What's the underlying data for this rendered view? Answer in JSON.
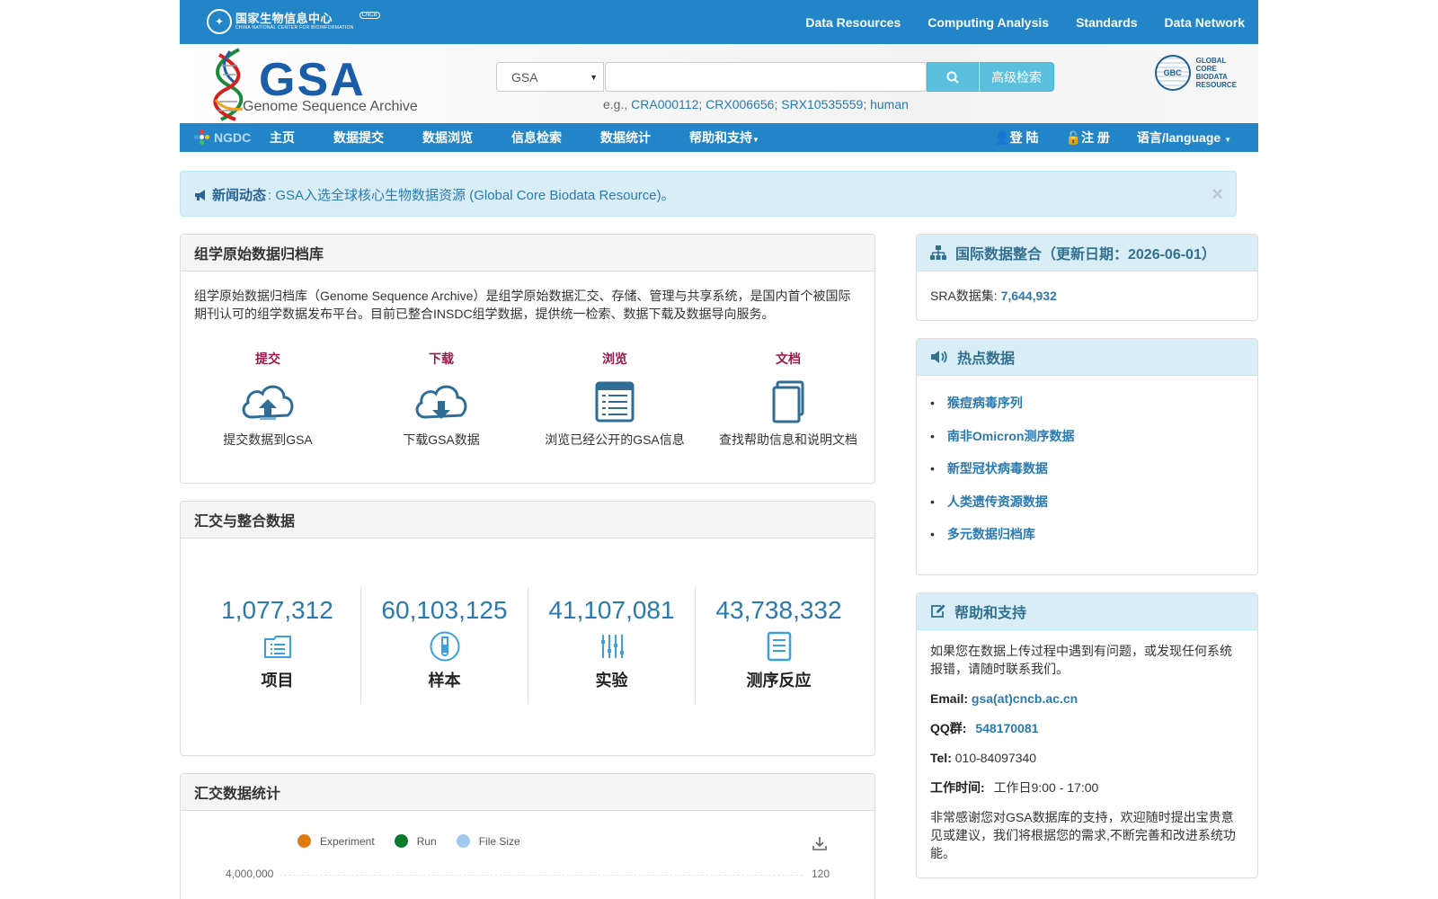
{
  "topbar": {
    "org_cn": "国家生物信息中心",
    "org_en": "CHINA NATIONAL CENTER FOR BIOINFORMATION",
    "org_badge": "CNCB",
    "nav": [
      "Data Resources",
      "Computing Analysis",
      "Standards",
      "Data Network"
    ]
  },
  "header": {
    "logo_title": "GSA",
    "logo_subtitle": "Genome Sequence Archive",
    "search_db": "GSA",
    "search_value": "",
    "advanced_label": "高级检索",
    "examples_prefix": "e.g.,",
    "examples": [
      "CRA000112",
      "CRX006656",
      "SRX10535559",
      "human"
    ],
    "gcbr_text": [
      "GLOBAL",
      "CORE",
      "BIODATA",
      "RESOURCE"
    ],
    "gcbr_badge": "GBC"
  },
  "mainnav": {
    "ngdc": "NGDC",
    "items": [
      "主页",
      "数据提交",
      "数据浏览",
      "信息检索",
      "数据统计",
      "帮助和支持"
    ],
    "login": "登 陆",
    "register": "注 册",
    "language": "语言/language"
  },
  "alert": {
    "label": "新闻动态",
    "text": ": GSA入选全球核心生物数据资源 (Global Core Biodata Resource)。",
    "close": "×"
  },
  "archive": {
    "title": "组学原始数据归档库",
    "intro": "组学原始数据归档库（Genome Sequence Archive）是组学原始数据汇交、存储、管理与共享系统，是国内首个被国际期刊认可的组学数据发布平台。目前已整合INSDC组学数据，提供统一检索、数据下载及数据导向服务。",
    "quick": [
      {
        "title": "提交",
        "desc": "提交数据到GSA",
        "icon": "cloud-upload-icon"
      },
      {
        "title": "下载",
        "desc": "下载GSA数据",
        "icon": "cloud-download-icon"
      },
      {
        "title": "浏览",
        "desc": "浏览已经公开的GSA信息",
        "icon": "list-document-icon"
      },
      {
        "title": "文档",
        "desc": "查找帮助信息和说明文档",
        "icon": "documents-icon"
      }
    ]
  },
  "integration": {
    "title": "汇交与整合数据",
    "stats": [
      {
        "value": "1,077,312",
        "label": "项目",
        "icon": "project-icon"
      },
      {
        "value": "60,103,125",
        "label": "样本",
        "icon": "sample-tube-icon"
      },
      {
        "value": "41,107,081",
        "label": "实验",
        "icon": "experiment-icon"
      },
      {
        "value": "43,738,332",
        "label": "测序反应",
        "icon": "run-document-icon"
      }
    ]
  },
  "submission_stats": {
    "title": "汇交数据统计",
    "legend": [
      {
        "name": "Experiment",
        "color": "#e07b10"
      },
      {
        "name": "Run",
        "color": "#0c7a2c"
      },
      {
        "name": "File Size",
        "color": "#a4c8f0"
      }
    ],
    "y_left_top": "4,000,000",
    "y_right_top": "120"
  },
  "intl": {
    "title": "国际数据整合（更新日期：2026-06-01）",
    "sra_label": "SRA数据集:",
    "sra_value": "7,644,932"
  },
  "hot": {
    "title": "热点数据",
    "items": [
      "猴痘病毒序列",
      "南非Omicron测序数据",
      "新型冠状病毒数据",
      "人类遗传资源数据",
      "多元数据归档库"
    ]
  },
  "help": {
    "title": "帮助和支持",
    "intro": "如果您在数据上传过程中遇到有问题，或发现任何系统报错，请随时联系我们。",
    "email_label": "Email:",
    "email": "gsa(at)cncb.ac.cn",
    "qq_label": "QQ群:",
    "qq": "548170081",
    "tel_label": "Tel:",
    "tel": "010-84097340",
    "hours_label": "工作时间:",
    "hours": "工作日9:00 - 17:00",
    "thanks": "非常感谢您对GSA数据库的支持，欢迎随时提出宝贵意见或建议，我们将根据您的需求,不断完善和改进系统功能。"
  },
  "colors": {
    "primary_blue": "#2285c7",
    "link_blue": "#2a7ab0",
    "quick_title": "#9a1a4a",
    "info_bg": "#d9edf7"
  }
}
